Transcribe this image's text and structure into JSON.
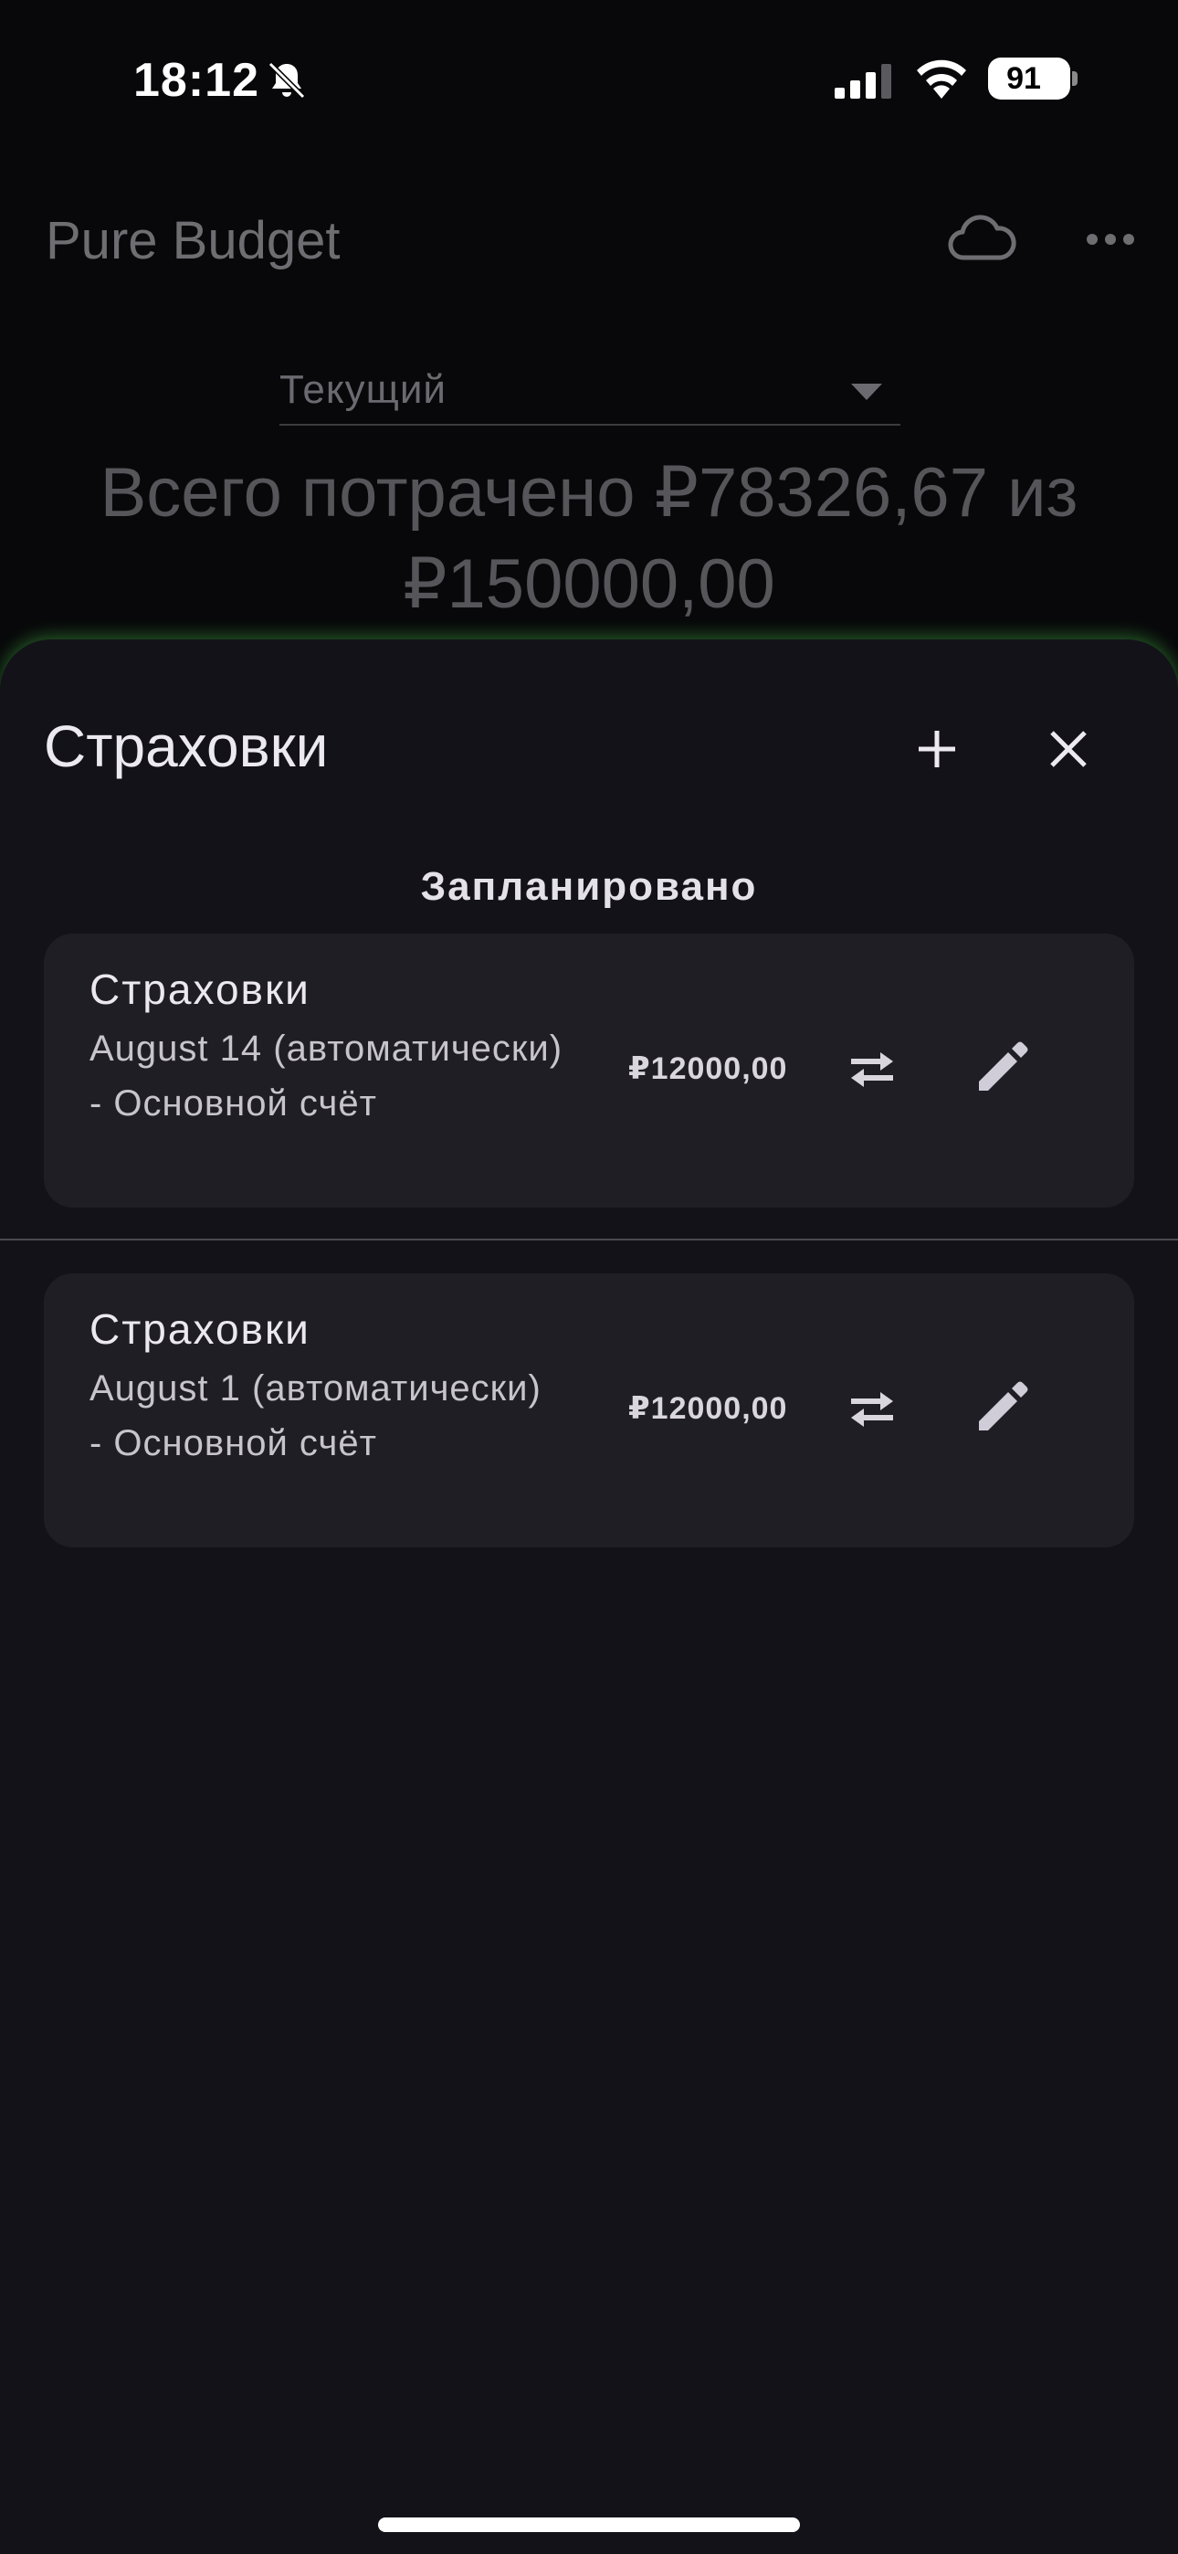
{
  "status_bar": {
    "time": "18:12",
    "battery": "91",
    "icons": [
      "bell-slash-icon",
      "cellular-signal-icon",
      "wifi-icon",
      "battery-icon"
    ]
  },
  "app": {
    "title": "Pure Budget",
    "header_icons": [
      "cloud-icon",
      "more-icon"
    ],
    "period": {
      "selected": "Текущий"
    },
    "spent_summary": "Всего потрачено ₽78326,67 из ₽150000,00"
  },
  "sheet": {
    "title": "Страховки",
    "icons": [
      "add-icon",
      "close-icon"
    ],
    "section_title": "Запланировано",
    "items": [
      {
        "name": "Страховки",
        "details": "August 14 (автоматически) - Основной счёт",
        "amount": "₽12000,00"
      },
      {
        "name": "Страховки",
        "details": "August 1 (автоматически) - Основной счёт",
        "amount": "₽12000,00"
      }
    ]
  },
  "colors": {
    "background": "#08080a",
    "sheet": "#131219",
    "card": "#1f1e24",
    "glow": "#46be46"
  }
}
